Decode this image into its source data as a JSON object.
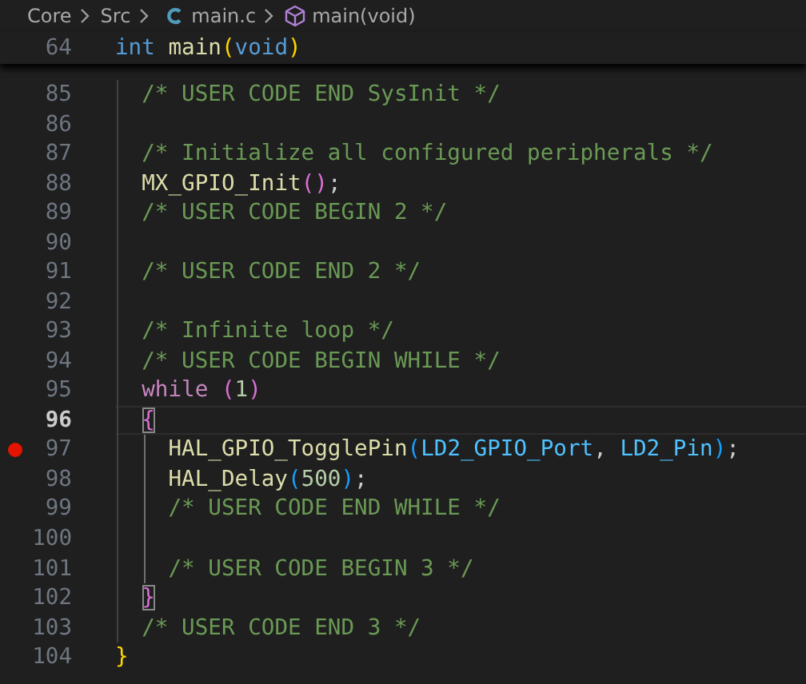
{
  "breadcrumb": [
    {
      "kind": "folder",
      "label": "Core"
    },
    {
      "kind": "folder",
      "label": "Src"
    },
    {
      "kind": "c-file",
      "label": "main.c"
    },
    {
      "kind": "function",
      "label": "main(void)"
    }
  ],
  "sticky_line": {
    "number": "64",
    "tokens": [
      {
        "kind": "keyword",
        "text": "int"
      },
      {
        "kind": "func",
        "text": " main"
      },
      {
        "kind": "bracket1",
        "text": "("
      },
      {
        "kind": "keyword",
        "text": "void"
      },
      {
        "kind": "bracket1",
        "text": ")"
      }
    ]
  },
  "lines": [
    {
      "number": "85",
      "current": false,
      "breakpoint": false,
      "tokens": [
        {
          "kind": "comment",
          "text": "  /* USER CODE END SysInit */"
        }
      ]
    },
    {
      "number": "86",
      "current": false,
      "breakpoint": false
    },
    {
      "number": "87",
      "current": false,
      "breakpoint": false,
      "tokens": [
        {
          "kind": "comment",
          "text": "  /* Initialize all configured peripherals */"
        }
      ]
    },
    {
      "number": "88",
      "current": false,
      "breakpoint": false,
      "tokens": [
        {
          "kind": "func",
          "text": "  MX_GPIO_Init"
        },
        {
          "kind": "bracket2",
          "text": "()"
        },
        {
          "kind": "plain",
          "text": ";"
        }
      ]
    },
    {
      "number": "89",
      "current": false,
      "breakpoint": false,
      "tokens": [
        {
          "kind": "comment",
          "text": "  /* USER CODE BEGIN 2 */"
        }
      ]
    },
    {
      "number": "90",
      "current": false,
      "breakpoint": false
    },
    {
      "number": "91",
      "current": false,
      "breakpoint": false,
      "tokens": [
        {
          "kind": "comment",
          "text": "  /* USER CODE END 2 */"
        }
      ]
    },
    {
      "number": "92",
      "current": false,
      "breakpoint": false
    },
    {
      "number": "93",
      "current": false,
      "breakpoint": false,
      "tokens": [
        {
          "kind": "comment",
          "text": "  /* Infinite loop */"
        }
      ]
    },
    {
      "number": "94",
      "current": false,
      "breakpoint": false,
      "tokens": [
        {
          "kind": "comment",
          "text": "  /* USER CODE BEGIN WHILE */"
        }
      ]
    },
    {
      "number": "95",
      "current": false,
      "breakpoint": false,
      "tokens": [
        {
          "kind": "control",
          "text": "  while"
        },
        {
          "kind": "bracket2",
          "text": " ("
        },
        {
          "kind": "number",
          "text": "1"
        },
        {
          "kind": "bracket2",
          "text": ")"
        }
      ]
    },
    {
      "number": "96",
      "current": true,
      "breakpoint": false,
      "tokens": [
        {
          "kind": "bracket2",
          "text": "  {",
          "matched": true
        }
      ]
    },
    {
      "number": "97",
      "current": false,
      "breakpoint": true,
      "tokens": [
        {
          "kind": "func",
          "text": "    HAL_GPIO_TogglePin"
        },
        {
          "kind": "bracket3",
          "text": "("
        },
        {
          "kind": "var",
          "text": "LD2_GPIO_Port"
        },
        {
          "kind": "plain",
          "text": ", "
        },
        {
          "kind": "var",
          "text": "LD2_Pin"
        },
        {
          "kind": "bracket3",
          "text": ")"
        },
        {
          "kind": "plain",
          "text": ";"
        }
      ]
    },
    {
      "number": "98",
      "current": false,
      "breakpoint": false,
      "tokens": [
        {
          "kind": "func",
          "text": "    HAL_Delay"
        },
        {
          "kind": "bracket3",
          "text": "("
        },
        {
          "kind": "number",
          "text": "500"
        },
        {
          "kind": "bracket3",
          "text": ")"
        },
        {
          "kind": "plain",
          "text": ";"
        }
      ]
    },
    {
      "number": "99",
      "current": false,
      "breakpoint": false,
      "tokens": [
        {
          "kind": "comment",
          "text": "    /* USER CODE END WHILE */"
        }
      ]
    },
    {
      "number": "100",
      "current": false,
      "breakpoint": false
    },
    {
      "number": "101",
      "current": false,
      "breakpoint": false,
      "tokens": [
        {
          "kind": "comment",
          "text": "    /* USER CODE BEGIN 3 */"
        }
      ]
    },
    {
      "number": "102",
      "current": false,
      "breakpoint": false,
      "tokens": [
        {
          "kind": "bracket2",
          "text": "  }",
          "matched": true
        }
      ]
    },
    {
      "number": "103",
      "current": false,
      "breakpoint": false,
      "tokens": [
        {
          "kind": "comment",
          "text": "  /* USER CODE END 3 */"
        }
      ]
    },
    {
      "number": "104",
      "current": false,
      "breakpoint": false,
      "tokens": [
        {
          "kind": "bracket1",
          "text": "}"
        }
      ]
    }
  ]
}
